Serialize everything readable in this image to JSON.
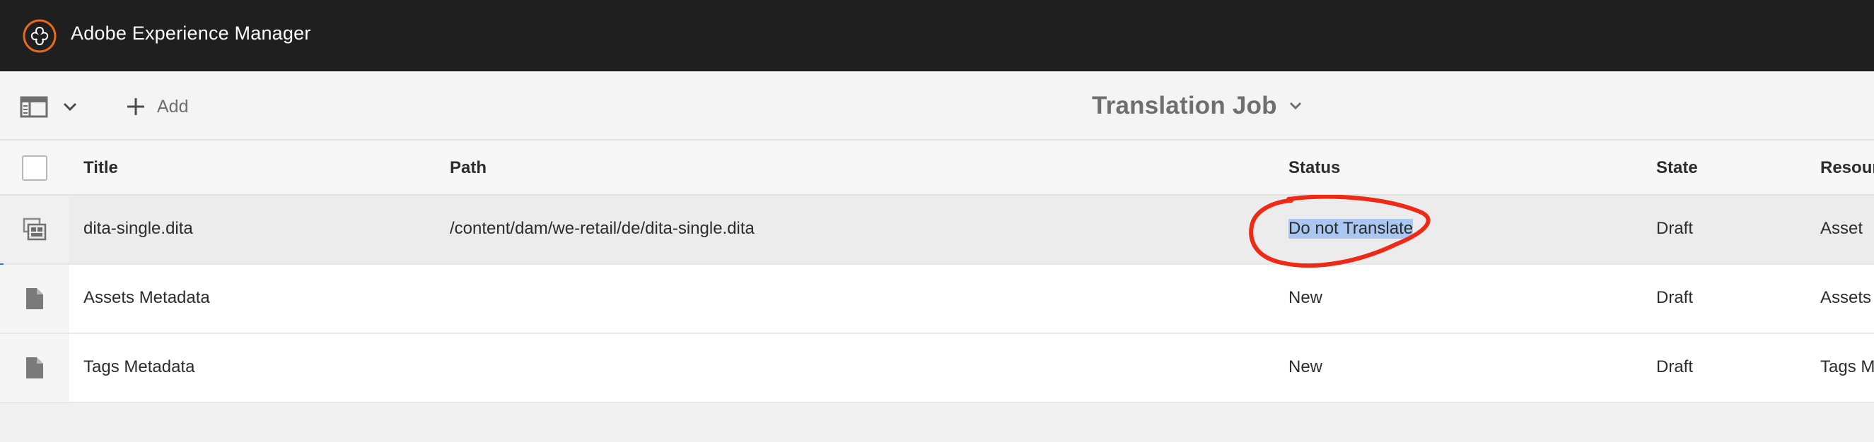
{
  "shell": {
    "brand_name": "Adobe Experience Manager",
    "logo_icon": "adobe-experience-manager-logo",
    "logo_color": "#e8691c"
  },
  "actionbar": {
    "rail_toggle_icon": "rail-toggle-icon",
    "add_label": "Add",
    "job_title": "Translation Job"
  },
  "table": {
    "columns": [
      "Title",
      "Path",
      "Status",
      "State",
      "Resour"
    ],
    "rows": [
      {
        "icon": "dita-file-icon",
        "title": "dita-single.dita",
        "path": "/content/dam/we-retail/de/dita-single.dita",
        "status": "Do not Translate",
        "state": "Draft",
        "resource": "Asset",
        "selected": true
      },
      {
        "icon": "document-icon",
        "title": "Assets Metadata",
        "path": "",
        "status": "New",
        "state": "Draft",
        "resource": "Assets i",
        "selected": false
      },
      {
        "icon": "document-icon",
        "title": "Tags Metadata",
        "path": "",
        "status": "New",
        "state": "Draft",
        "resource": "Tags Me",
        "selected": false
      }
    ]
  },
  "colors": {
    "header_bg": "#1f1f1f",
    "selection_accent": "#2680eb",
    "text_highlight": "#a9c7f0",
    "annotation_red": "#ee2a16"
  }
}
